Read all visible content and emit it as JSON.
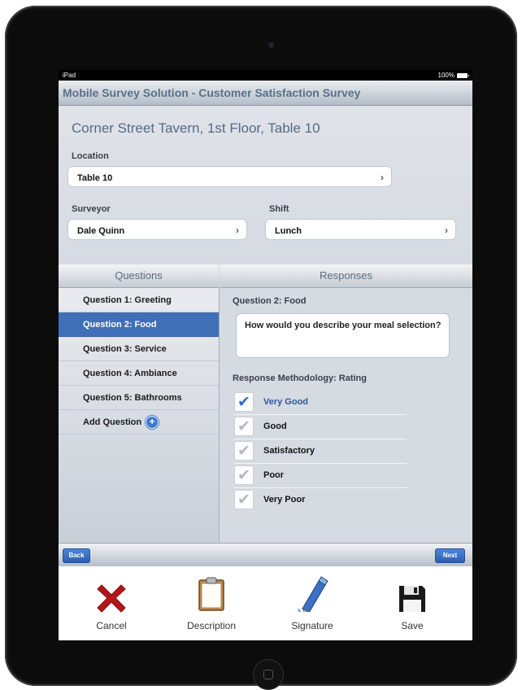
{
  "status_bar": {
    "carrier": "iPad",
    "battery": "100%"
  },
  "app": {
    "title": "Mobile Survey Solution - Customer Satisfaction Survey"
  },
  "header": {
    "place": "Corner Street Tavern, 1st Floor, Table 10",
    "location_label": "Location",
    "location_value": "Table 10",
    "surveyor_label": "Surveyor",
    "surveyor_value": "Dale Quinn",
    "shift_label": "Shift",
    "shift_value": "Lunch"
  },
  "questions": {
    "heading": "Questions",
    "items": [
      {
        "label": "Question 1: Greeting"
      },
      {
        "label": "Question 2: Food",
        "selected": true
      },
      {
        "label": "Question 3: Service"
      },
      {
        "label": "Question 4: Ambiance"
      },
      {
        "label": "Question 5: Bathrooms"
      }
    ],
    "add_label": "Add Question"
  },
  "responses": {
    "heading": "Responses",
    "question_title": "Question 2: Food",
    "question_text": "How would you describe your meal selection?",
    "methodology": "Response Methodology: Rating",
    "options": [
      {
        "label": "Very Good",
        "checked": true
      },
      {
        "label": "Good"
      },
      {
        "label": "Satisfactory"
      },
      {
        "label": "Poor"
      },
      {
        "label": "Very Poor"
      }
    ]
  },
  "toolbar": {
    "back": "Back",
    "next": "Next"
  },
  "tabs": {
    "cancel": "Cancel",
    "description": "Description",
    "signature": "Signature",
    "save": "Save"
  },
  "colors": {
    "accent": "#3f6fb6",
    "title": "#566a82",
    "cancel_red": "#b5161b"
  }
}
